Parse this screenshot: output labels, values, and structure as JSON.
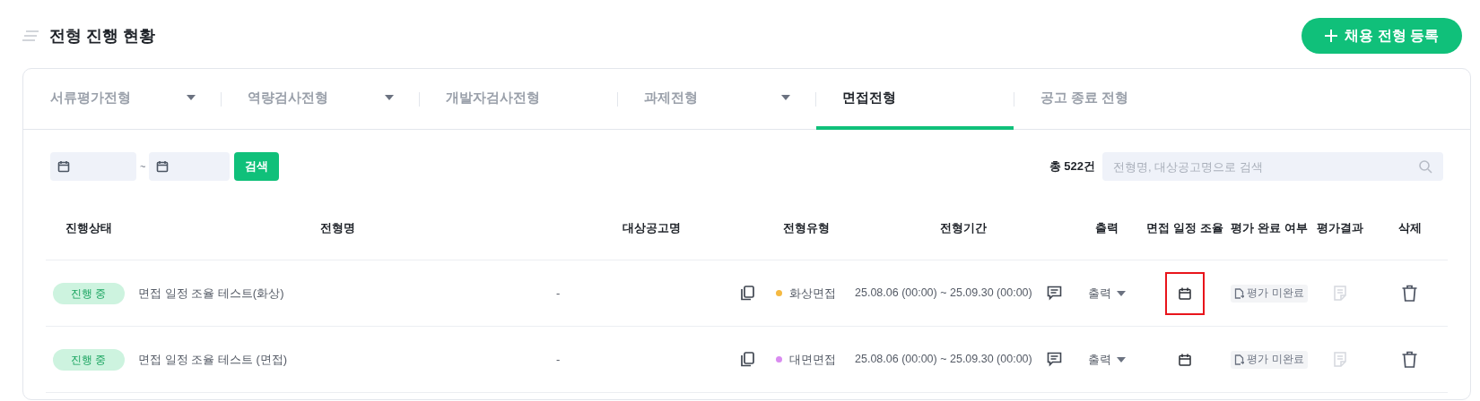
{
  "title": "전형 진행 현황",
  "register_button": "채용 전형 등록",
  "tabs": [
    {
      "label": "서류평가전형",
      "dropdown": true,
      "selected": false
    },
    {
      "label": "역량검사전형",
      "dropdown": true,
      "selected": false
    },
    {
      "label": "개발자검사전형",
      "dropdown": false,
      "selected": false
    },
    {
      "label": "과제전형",
      "dropdown": true,
      "selected": false
    },
    {
      "label": "면접전형",
      "dropdown": false,
      "selected": true
    },
    {
      "label": "공고 종료 전형",
      "dropdown": false,
      "selected": false
    }
  ],
  "filters": {
    "range_separator": "~",
    "search_button": "검색",
    "total": "총 522건",
    "search_placeholder": "전형명, 대상공고명으로 검색"
  },
  "table": {
    "columns": [
      "진행상태",
      "전형명",
      "대상공고명",
      "전형유형",
      "전형기간",
      "출력",
      "면접 일정 조율",
      "평가 완료 여부",
      "평가결과",
      "삭제"
    ],
    "rows": [
      {
        "status": "진행 중",
        "name": "면접 일정 조율 테스트(화상)",
        "posting": "-",
        "type": "화상면접",
        "color": "#f5b942",
        "period": "25.08.06 (00:00) ~ 25.09.30 (00:00)",
        "print": "출력",
        "schedule_highlighted": true,
        "evaluation": "평가 미완료"
      },
      {
        "status": "진행 중",
        "name": "면접 일정 조율 테스트 (면접)",
        "posting": "-",
        "type": "대면면접",
        "color": "#d98bf0",
        "period": "25.08.06 (00:00) ~ 25.09.30 (00:00)",
        "print": "출력",
        "schedule_highlighted": false,
        "evaluation": "평가 미완료"
      }
    ]
  }
}
